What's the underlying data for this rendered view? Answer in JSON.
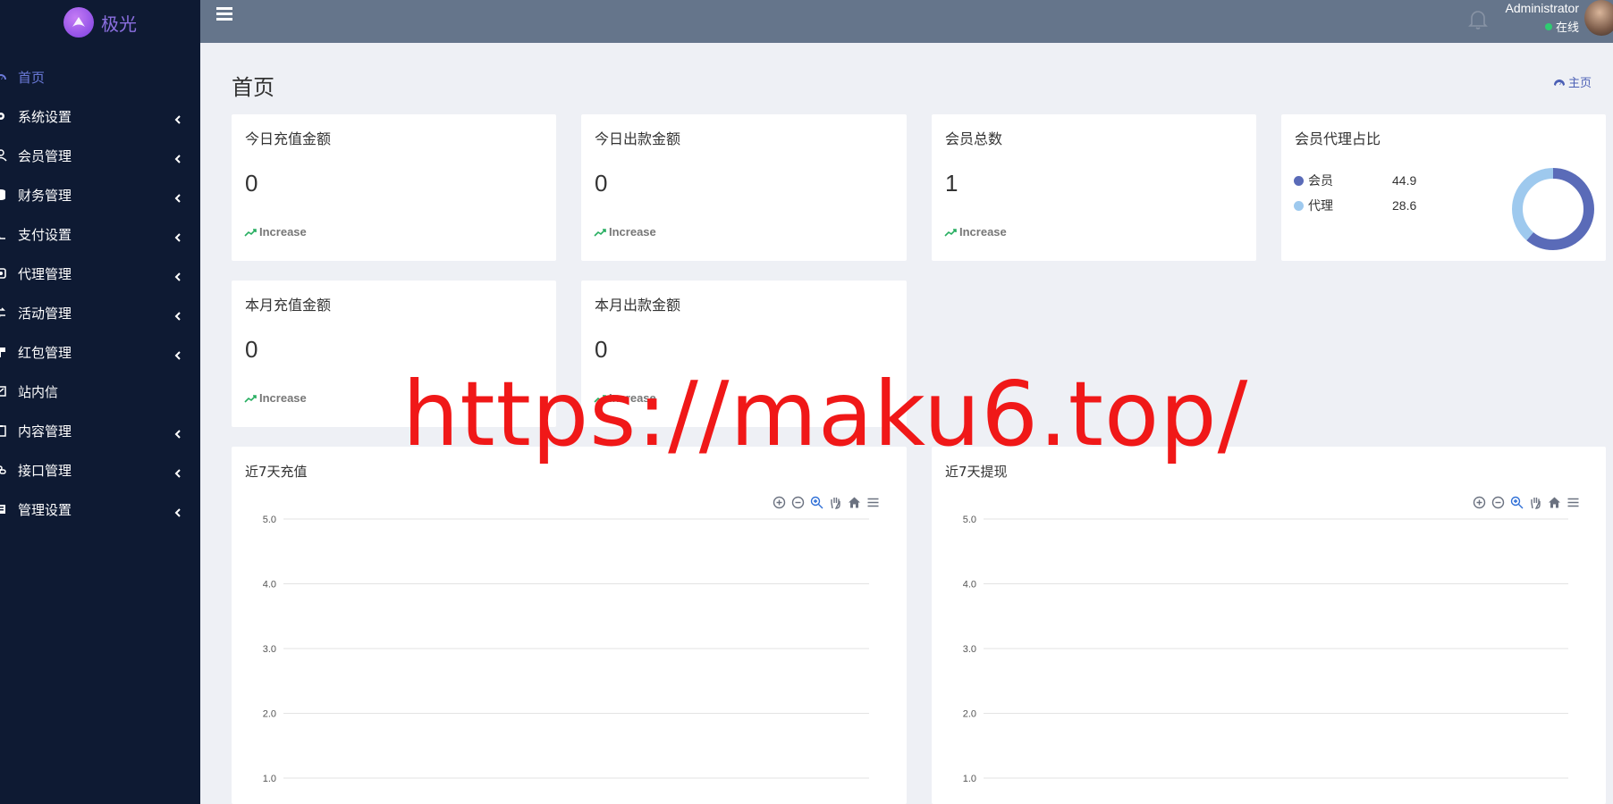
{
  "brand": {
    "name": "极光"
  },
  "sidebar": {
    "items": [
      {
        "label": "首页",
        "icon": "dashboard-icon",
        "active": true,
        "has_children": false
      },
      {
        "label": "系统设置",
        "icon": "cogs-icon",
        "has_children": true
      },
      {
        "label": "会员管理",
        "icon": "user-icon",
        "has_children": true
      },
      {
        "label": "财务管理",
        "icon": "database-icon",
        "has_children": true
      },
      {
        "label": "支付设置",
        "icon": "payment-icon",
        "has_children": true
      },
      {
        "label": "代理管理",
        "icon": "agent-icon",
        "has_children": true
      },
      {
        "label": "活动管理",
        "icon": "exchange-icon",
        "has_children": true
      },
      {
        "label": "红包管理",
        "icon": "gift-icon",
        "has_children": true
      },
      {
        "label": "站内信",
        "icon": "message-icon",
        "has_children": false
      },
      {
        "label": "内容管理",
        "icon": "clipboard-icon",
        "has_children": true
      },
      {
        "label": "接口管理",
        "icon": "link-icon",
        "has_children": true
      },
      {
        "label": "管理设置",
        "icon": "list-icon",
        "has_children": true
      }
    ]
  },
  "topbar": {
    "user_name": "Administrator",
    "user_status": "在线",
    "status_color": "#2ecc71"
  },
  "page": {
    "title": "首页",
    "breadcrumb": "主页"
  },
  "stats": [
    {
      "label": "今日充值金额",
      "value": "0",
      "trend": "Increase"
    },
    {
      "label": "今日出款金额",
      "value": "0",
      "trend": "Increase"
    },
    {
      "label": "会员总数",
      "value": "1",
      "trend": "Increase"
    },
    {
      "label": "本月充值金额",
      "value": "0",
      "trend": "Increase"
    },
    {
      "label": "本月出款金额",
      "value": "0",
      "trend": "Increase"
    }
  ],
  "ratio": {
    "label": "会员代理占比",
    "items": [
      {
        "name": "会员",
        "value": "44.9",
        "color": "#5a6bb8"
      },
      {
        "name": "代理",
        "value": "28.6",
        "color": "#9ec9ee"
      }
    ]
  },
  "chart_data": [
    {
      "type": "line",
      "title": "近7天充值",
      "ylim": [
        0,
        5
      ],
      "yticks": [
        "5.0",
        "4.0",
        "3.0",
        "2.0",
        "1.0"
      ],
      "grid": true
    },
    {
      "type": "line",
      "title": "近7天提现",
      "ylim": [
        0,
        5
      ],
      "yticks": [
        "5.0",
        "4.0",
        "3.0",
        "2.0",
        "1.0"
      ],
      "grid": true
    }
  ],
  "watermark": "https://maku6.top/"
}
